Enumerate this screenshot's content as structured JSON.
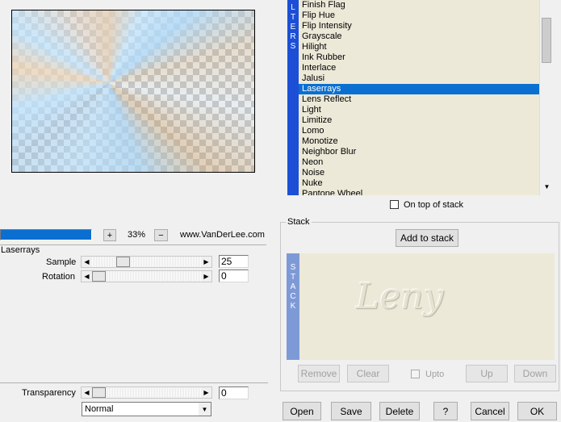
{
  "preview": {
    "zoom": "33%",
    "zoom_in": "+",
    "zoom_out": "−",
    "progress_fill": 1.0,
    "website": "www.VanDerLee.com"
  },
  "filters": {
    "tab_letters": [
      "L",
      "T",
      "E",
      "R",
      "S"
    ],
    "items": [
      "Finish Flag",
      "Flip Hue",
      "Flip Intensity",
      "Grayscale",
      "Hilight",
      "Ink Rubber",
      "Interlace",
      "Jalusi",
      "Laserrays",
      "Lens Reflect",
      "Light",
      "Limitize",
      "Lomo",
      "Monotize",
      "Neighbor Blur",
      "Neon",
      "Noise",
      "Nuke",
      "Pantone Wheel"
    ],
    "selected": "Laserrays",
    "on_top_label": "On top of stack"
  },
  "stack": {
    "title": "Stack",
    "add_label": "Add to stack",
    "tab_letters": [
      "S",
      "T",
      "A",
      "C",
      "K"
    ],
    "logo": "Leny",
    "remove_label": "Remove",
    "clear_label": "Clear",
    "upto_label": "Upto",
    "up_label": "Up",
    "down_label": "Down"
  },
  "params": {
    "title": "Laserrays",
    "sample_label": "Sample",
    "sample_value": "25",
    "sample_fraction": 0.25,
    "rotation_label": "Rotation",
    "rotation_value": "0",
    "rotation_fraction": 0.0,
    "transparency_label": "Transparency",
    "transparency_value": "0",
    "transparency_fraction": 0.0,
    "blend_mode": "Normal"
  },
  "footer": {
    "open_label": "Open",
    "save_label": "Save",
    "delete_label": "Delete",
    "help_label": "?",
    "cancel_label": "Cancel",
    "ok_label": "OK"
  },
  "colors": {
    "accent": "#0a6fd1",
    "filters_tab": "#1c4fd6",
    "stack_tab": "#7e9ad6",
    "list_bg": "#ece9d8"
  }
}
